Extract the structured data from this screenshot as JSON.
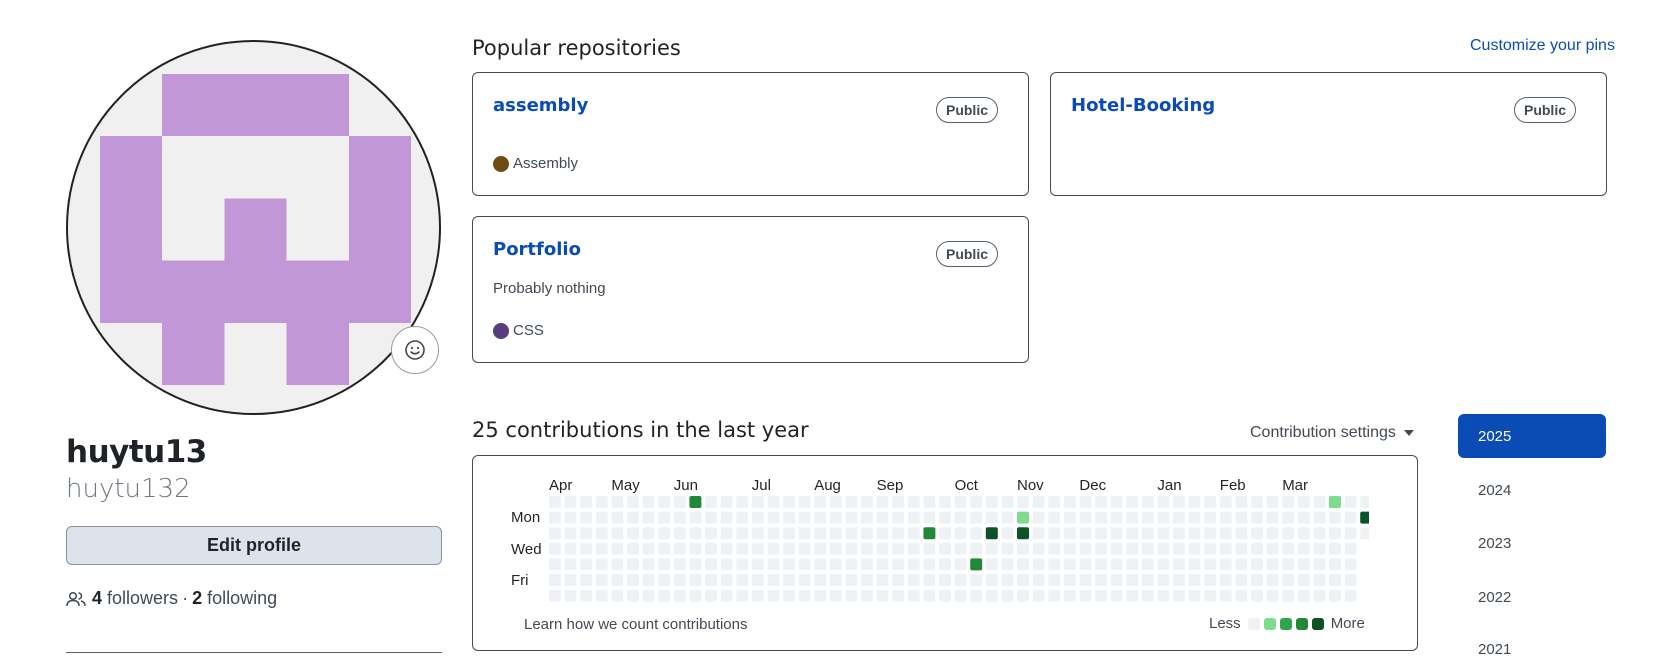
{
  "profile": {
    "display_name": "huytu13",
    "username": "huytu132",
    "edit_button": "Edit profile",
    "followers_count": "4",
    "followers_label": "followers",
    "separator": "·",
    "following_count": "2",
    "following_label": "following",
    "avatar_color": "#c297d8",
    "avatar_bg": "#f0f0f0"
  },
  "pinned": {
    "title": "Popular repositories",
    "customize_link": "Customize your pins",
    "repos": [
      {
        "name": "assembly",
        "visibility": "Public",
        "description": "",
        "language": "Assembly",
        "language_color": "#6E4C13"
      },
      {
        "name": "Hotel-Booking",
        "visibility": "Public",
        "description": "",
        "language": "",
        "language_color": ""
      },
      {
        "name": "Portfolio",
        "visibility": "Public",
        "description": "Probably nothing",
        "language": "CSS",
        "language_color": "#563d7c"
      }
    ]
  },
  "contributions": {
    "title": "25 contributions in the last year",
    "settings_label": "Contribution settings",
    "months": [
      "Apr",
      "May",
      "Jun",
      "Jul",
      "Aug",
      "Sep",
      "Oct",
      "Nov",
      "Dec",
      "Jan",
      "Feb",
      "Mar"
    ],
    "days": [
      "Mon",
      "Wed",
      "Fri"
    ],
    "learn_link": "Learn how we count contributions",
    "legend_less": "Less",
    "legend_more": "More",
    "level_colors": [
      "#eff2f5",
      "#7fdc8f",
      "#2ea44f",
      "#218838",
      "#0b5326"
    ],
    "active_cells": [
      {
        "week": 9,
        "day": 0,
        "level": 3
      },
      {
        "week": 30,
        "day": 1,
        "level": 1
      },
      {
        "week": 24,
        "day": 2,
        "level": 3
      },
      {
        "week": 28,
        "day": 2,
        "level": 4
      },
      {
        "week": 30,
        "day": 2,
        "level": 4
      },
      {
        "week": 27,
        "day": 4,
        "level": 3
      },
      {
        "week": 50,
        "day": 0,
        "level": 1
      },
      {
        "week": 52,
        "day": 1,
        "level": 4
      }
    ]
  },
  "years": [
    "2025",
    "2024",
    "2023",
    "2022",
    "2021"
  ],
  "selected_year": "2025"
}
